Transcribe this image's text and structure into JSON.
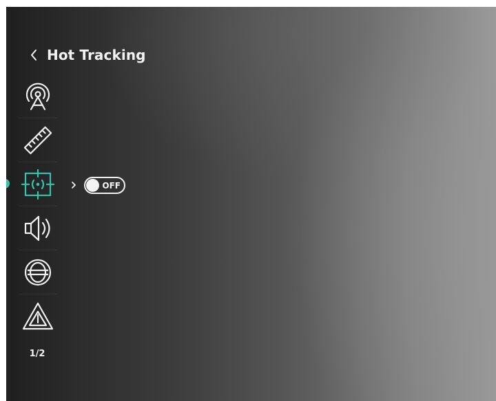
{
  "header": {
    "back_icon": "chevron-left-icon",
    "title": "Hot Tracking"
  },
  "menu": {
    "items": [
      {
        "icon": "signal-tower-icon",
        "selected": false
      },
      {
        "icon": "ruler-icon",
        "selected": false
      },
      {
        "icon": "hot-tracking-target-icon",
        "selected": true
      },
      {
        "icon": "speaker-icon",
        "selected": false
      },
      {
        "icon": "globe-icon",
        "selected": false
      },
      {
        "icon": "warning-triangle-icon",
        "selected": false
      }
    ],
    "accent_color": "#36c3ad"
  },
  "submenu": {
    "expand_icon": "chevron-right-icon",
    "toggle": {
      "state": "OFF",
      "label": "OFF"
    }
  },
  "pager": {
    "text": "1/2"
  }
}
